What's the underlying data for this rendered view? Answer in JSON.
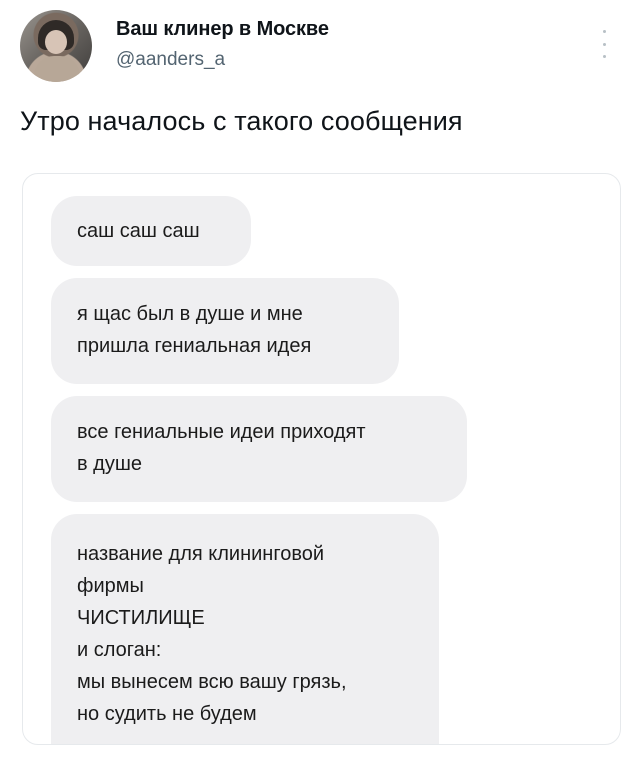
{
  "author": {
    "name": "Ваш клинер в Москве",
    "handle": "@aanders_a"
  },
  "tweet": {
    "text": "Утро началось с такого сообщения"
  },
  "messages": [
    "саш саш саш",
    "я щас был в душе и мне\nпришла гениальная идея",
    "все гениальные идеи приходят\nв душе",
    "название для клининговой\nфирмы\nЧИСТИЛИЩЕ\nи слоган:\nмы вынесем всю вашу грязь,\nно судить не будем"
  ],
  "icons": {
    "more": "more-vertical-icon",
    "avatar": "profile-avatar"
  },
  "colors": {
    "bubble": "#efeff1",
    "secondary_text": "#536471",
    "primary_text": "#0f1419"
  }
}
